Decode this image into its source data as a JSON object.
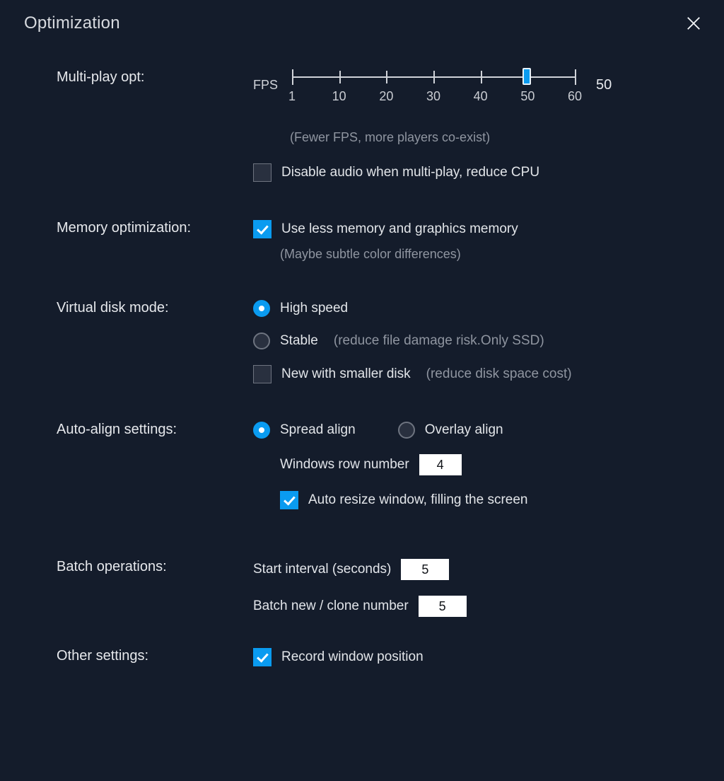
{
  "title": "Optimization",
  "multiPlay": {
    "label": "Multi-play opt:",
    "fpsPrefix": "FPS",
    "value": "50",
    "min": 1,
    "max": 60,
    "ticks": [
      "1",
      "10",
      "20",
      "30",
      "40",
      "50",
      "60"
    ],
    "hint": "(Fewer FPS, more players co-exist)",
    "disableAudio": {
      "checked": false,
      "label": "Disable audio when multi-play, reduce CPU"
    }
  },
  "memory": {
    "label": "Memory optimization:",
    "useLess": {
      "checked": true,
      "label": "Use less memory and graphics memory"
    },
    "hint": "(Maybe subtle color differences)"
  },
  "vdisk": {
    "label": "Virtual disk mode:",
    "highSpeed": {
      "selected": true,
      "label": "High speed"
    },
    "stable": {
      "selected": false,
      "label": "Stable",
      "sub": "(reduce file damage risk.Only SSD)"
    },
    "smaller": {
      "checked": false,
      "label": "New with smaller disk",
      "sub": "(reduce disk space cost)"
    }
  },
  "autoAlign": {
    "label": "Auto-align settings:",
    "spread": {
      "selected": true,
      "label": "Spread align"
    },
    "overlay": {
      "selected": false,
      "label": "Overlay align"
    },
    "rowNumLabel": "Windows row number",
    "rowNum": "4",
    "autoResize": {
      "checked": true,
      "label": "Auto resize window, filling the screen"
    }
  },
  "batch": {
    "label": "Batch operations:",
    "startIntervalLabel": "Start interval (seconds)",
    "startInterval": "5",
    "cloneLabel": "Batch new / clone number",
    "cloneNum": "5"
  },
  "other": {
    "label": "Other settings:",
    "recordPos": {
      "checked": true,
      "label": "Record window position"
    }
  }
}
